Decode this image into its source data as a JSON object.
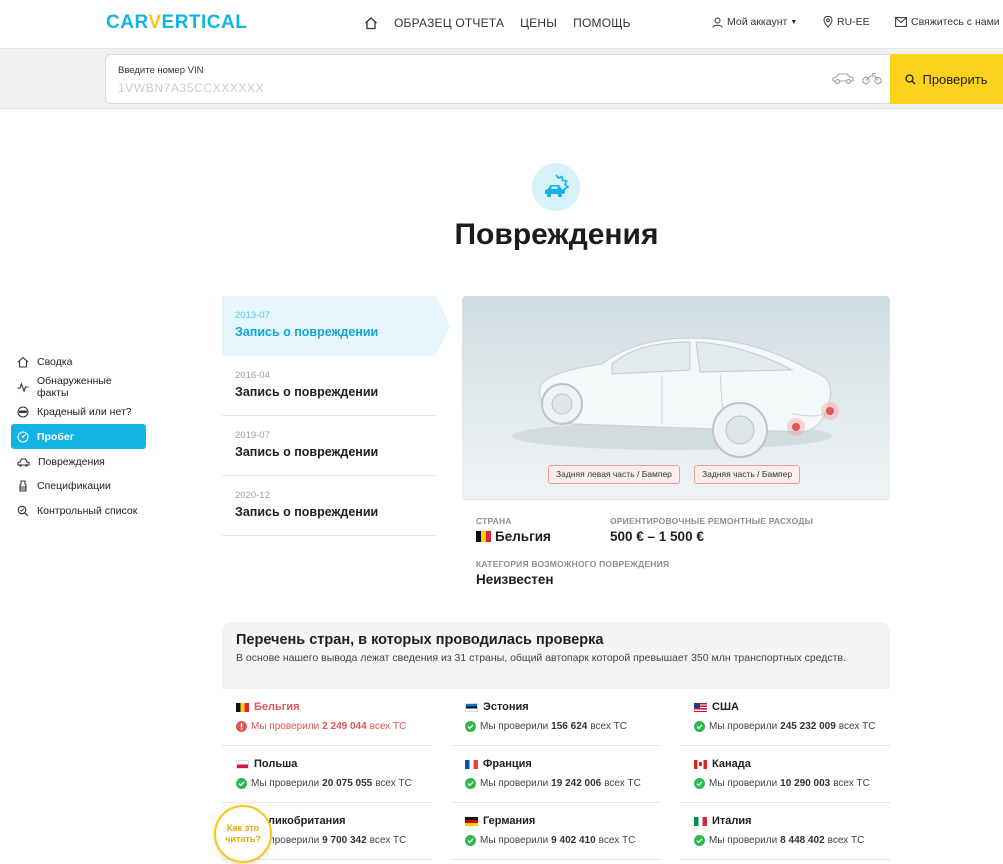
{
  "header": {
    "logo_text_a": "CAR",
    "logo_text_v": "V",
    "logo_text_b": "ERTICAL",
    "nav": [
      "ОБРАЗЕЦ ОТЧЕТА",
      "ЦЕНЫ",
      "ПОМОЩЬ"
    ],
    "account": "Мой аккаунт",
    "locale": "RU-EE",
    "contact": "Свяжитесь с нами"
  },
  "search": {
    "label": "Введите номер VIN",
    "placeholder": "1VWBN7A35CCXXXXXX",
    "button": "Проверить"
  },
  "section": {
    "title": "Повреждения"
  },
  "sidebar": {
    "items": [
      {
        "label": "Сводка",
        "icon": "home-icon"
      },
      {
        "label": "Обнаруженные факты",
        "icon": "pulse-icon"
      },
      {
        "label": "Краденый или нет?",
        "icon": "thief-icon"
      },
      {
        "label": "Пробег",
        "icon": "speedometer-icon",
        "active": true
      },
      {
        "label": "Повреждения",
        "icon": "car-damage-icon"
      },
      {
        "label": "Спецификации",
        "icon": "spec-icon"
      },
      {
        "label": "Контрольный список",
        "icon": "magnifier-icon"
      }
    ]
  },
  "records": [
    {
      "date": "2013-07",
      "title": "Запись о повреждении",
      "active": true
    },
    {
      "date": "2016-04",
      "title": "Запись о повреждении"
    },
    {
      "date": "2019-07",
      "title": "Запись о повреждении"
    },
    {
      "date": "2020-12",
      "title": "Запись о повреждении"
    }
  ],
  "damage": {
    "tags": [
      "Задняя левая часть / Бампер",
      "Задняя часть / Бампер"
    ],
    "country_label": "СТРАНА",
    "country": "Бельгия",
    "cost_label": "ОРИЕНТИРОВОЧНЫЕ РЕМОНТНЫЕ РАСХОДЫ",
    "cost": "500 € – 1 500 €",
    "category_label": "КАТЕГОРИЯ ВОЗМОЖНОГО ПОВРЕЖДЕНИЯ",
    "category": "Неизвестен"
  },
  "countries": {
    "title": "Перечень стран, в которых проводилась проверка",
    "description": "В основе нашего вывода лежат сведения из 31 страны, общий автопарк которой превышает 350 млн транспортных средств.",
    "prefix": "Мы проверили",
    "suffix": "всех ТС",
    "items": [
      {
        "name": "Бельгия",
        "count": "2 249 044",
        "status": "warning"
      },
      {
        "name": "Эстония",
        "count": "156 624",
        "status": "ok"
      },
      {
        "name": "США",
        "count": "245 232 009",
        "status": "ok"
      },
      {
        "name": "Польша",
        "count": "20 075 055",
        "status": "ok"
      },
      {
        "name": "Франция",
        "count": "19 242 006",
        "status": "ok"
      },
      {
        "name": "Канада",
        "count": "10 290 003",
        "status": "ok"
      },
      {
        "name": "Великобритания",
        "count": "9 700 342",
        "status": "ok"
      },
      {
        "name": "Германия",
        "count": "9 402 410",
        "status": "ok"
      },
      {
        "name": "Италия",
        "count": "8 448 402",
        "status": "ok"
      }
    ]
  },
  "help_badge": "Как это читать?",
  "colors": {
    "brand": "#11b4e3",
    "accent": "#fcd21c",
    "warning": "#e35454",
    "ok": "#2db84c"
  }
}
